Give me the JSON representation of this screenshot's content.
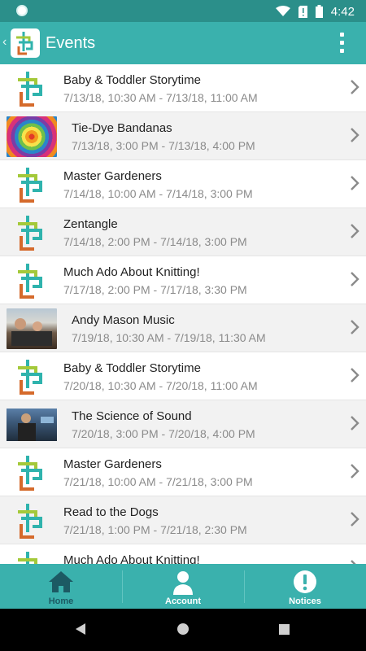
{
  "status_bar": {
    "time": "4:42"
  },
  "app_bar": {
    "back_glyph": "‹",
    "title": "Events",
    "menu_icon": "more-vert-icon"
  },
  "events": [
    {
      "title": "Baby & Toddler Storytime",
      "date": "7/13/18, 10:30 AM - 7/13/18, 11:00 AM",
      "thumb": "logo"
    },
    {
      "title": "Tie-Dye Bandanas",
      "date": "7/13/18, 3:00 PM - 7/13/18, 4:00 PM",
      "thumb": "tie-dye"
    },
    {
      "title": "Master Gardeners",
      "date": "7/14/18, 10:00 AM - 7/14/18, 3:00 PM",
      "thumb": "logo"
    },
    {
      "title": "Zentangle",
      "date": "7/14/18, 2:00 PM - 7/14/18, 3:00 PM",
      "thumb": "logo"
    },
    {
      "title": "Much Ado About Knitting!",
      "date": "7/17/18, 2:00 PM - 7/17/18, 3:30 PM",
      "thumb": "logo"
    },
    {
      "title": "Andy Mason Music",
      "date": "7/19/18, 10:30 AM - 7/19/18, 11:30 AM",
      "thumb": "band"
    },
    {
      "title": "Baby & Toddler Storytime",
      "date": "7/20/18, 10:30 AM - 7/20/18, 11:00 AM",
      "thumb": "logo"
    },
    {
      "title": "The Science of Sound",
      "date": "7/20/18, 3:00 PM - 7/20/18, 4:00 PM",
      "thumb": "science"
    },
    {
      "title": "Master Gardeners",
      "date": "7/21/18, 10:00 AM - 7/21/18, 3:00 PM",
      "thumb": "logo"
    },
    {
      "title": "Read to the Dogs",
      "date": "7/21/18, 1:00 PM - 7/21/18, 2:30 PM",
      "thumb": "logo"
    },
    {
      "title": "Much Ado About Knitting!",
      "date": "",
      "thumb": "logo"
    }
  ],
  "tabs": [
    {
      "label": "Home",
      "icon": "home-icon"
    },
    {
      "label": "Account",
      "icon": "person-icon"
    },
    {
      "label": "Notices",
      "icon": "alert-icon"
    }
  ],
  "colors": {
    "app_bar": "#3ab1ad",
    "status_bar": "#2b8f8a",
    "tab_active": "#1c5a63",
    "tab_inactive": "#ffffff"
  }
}
